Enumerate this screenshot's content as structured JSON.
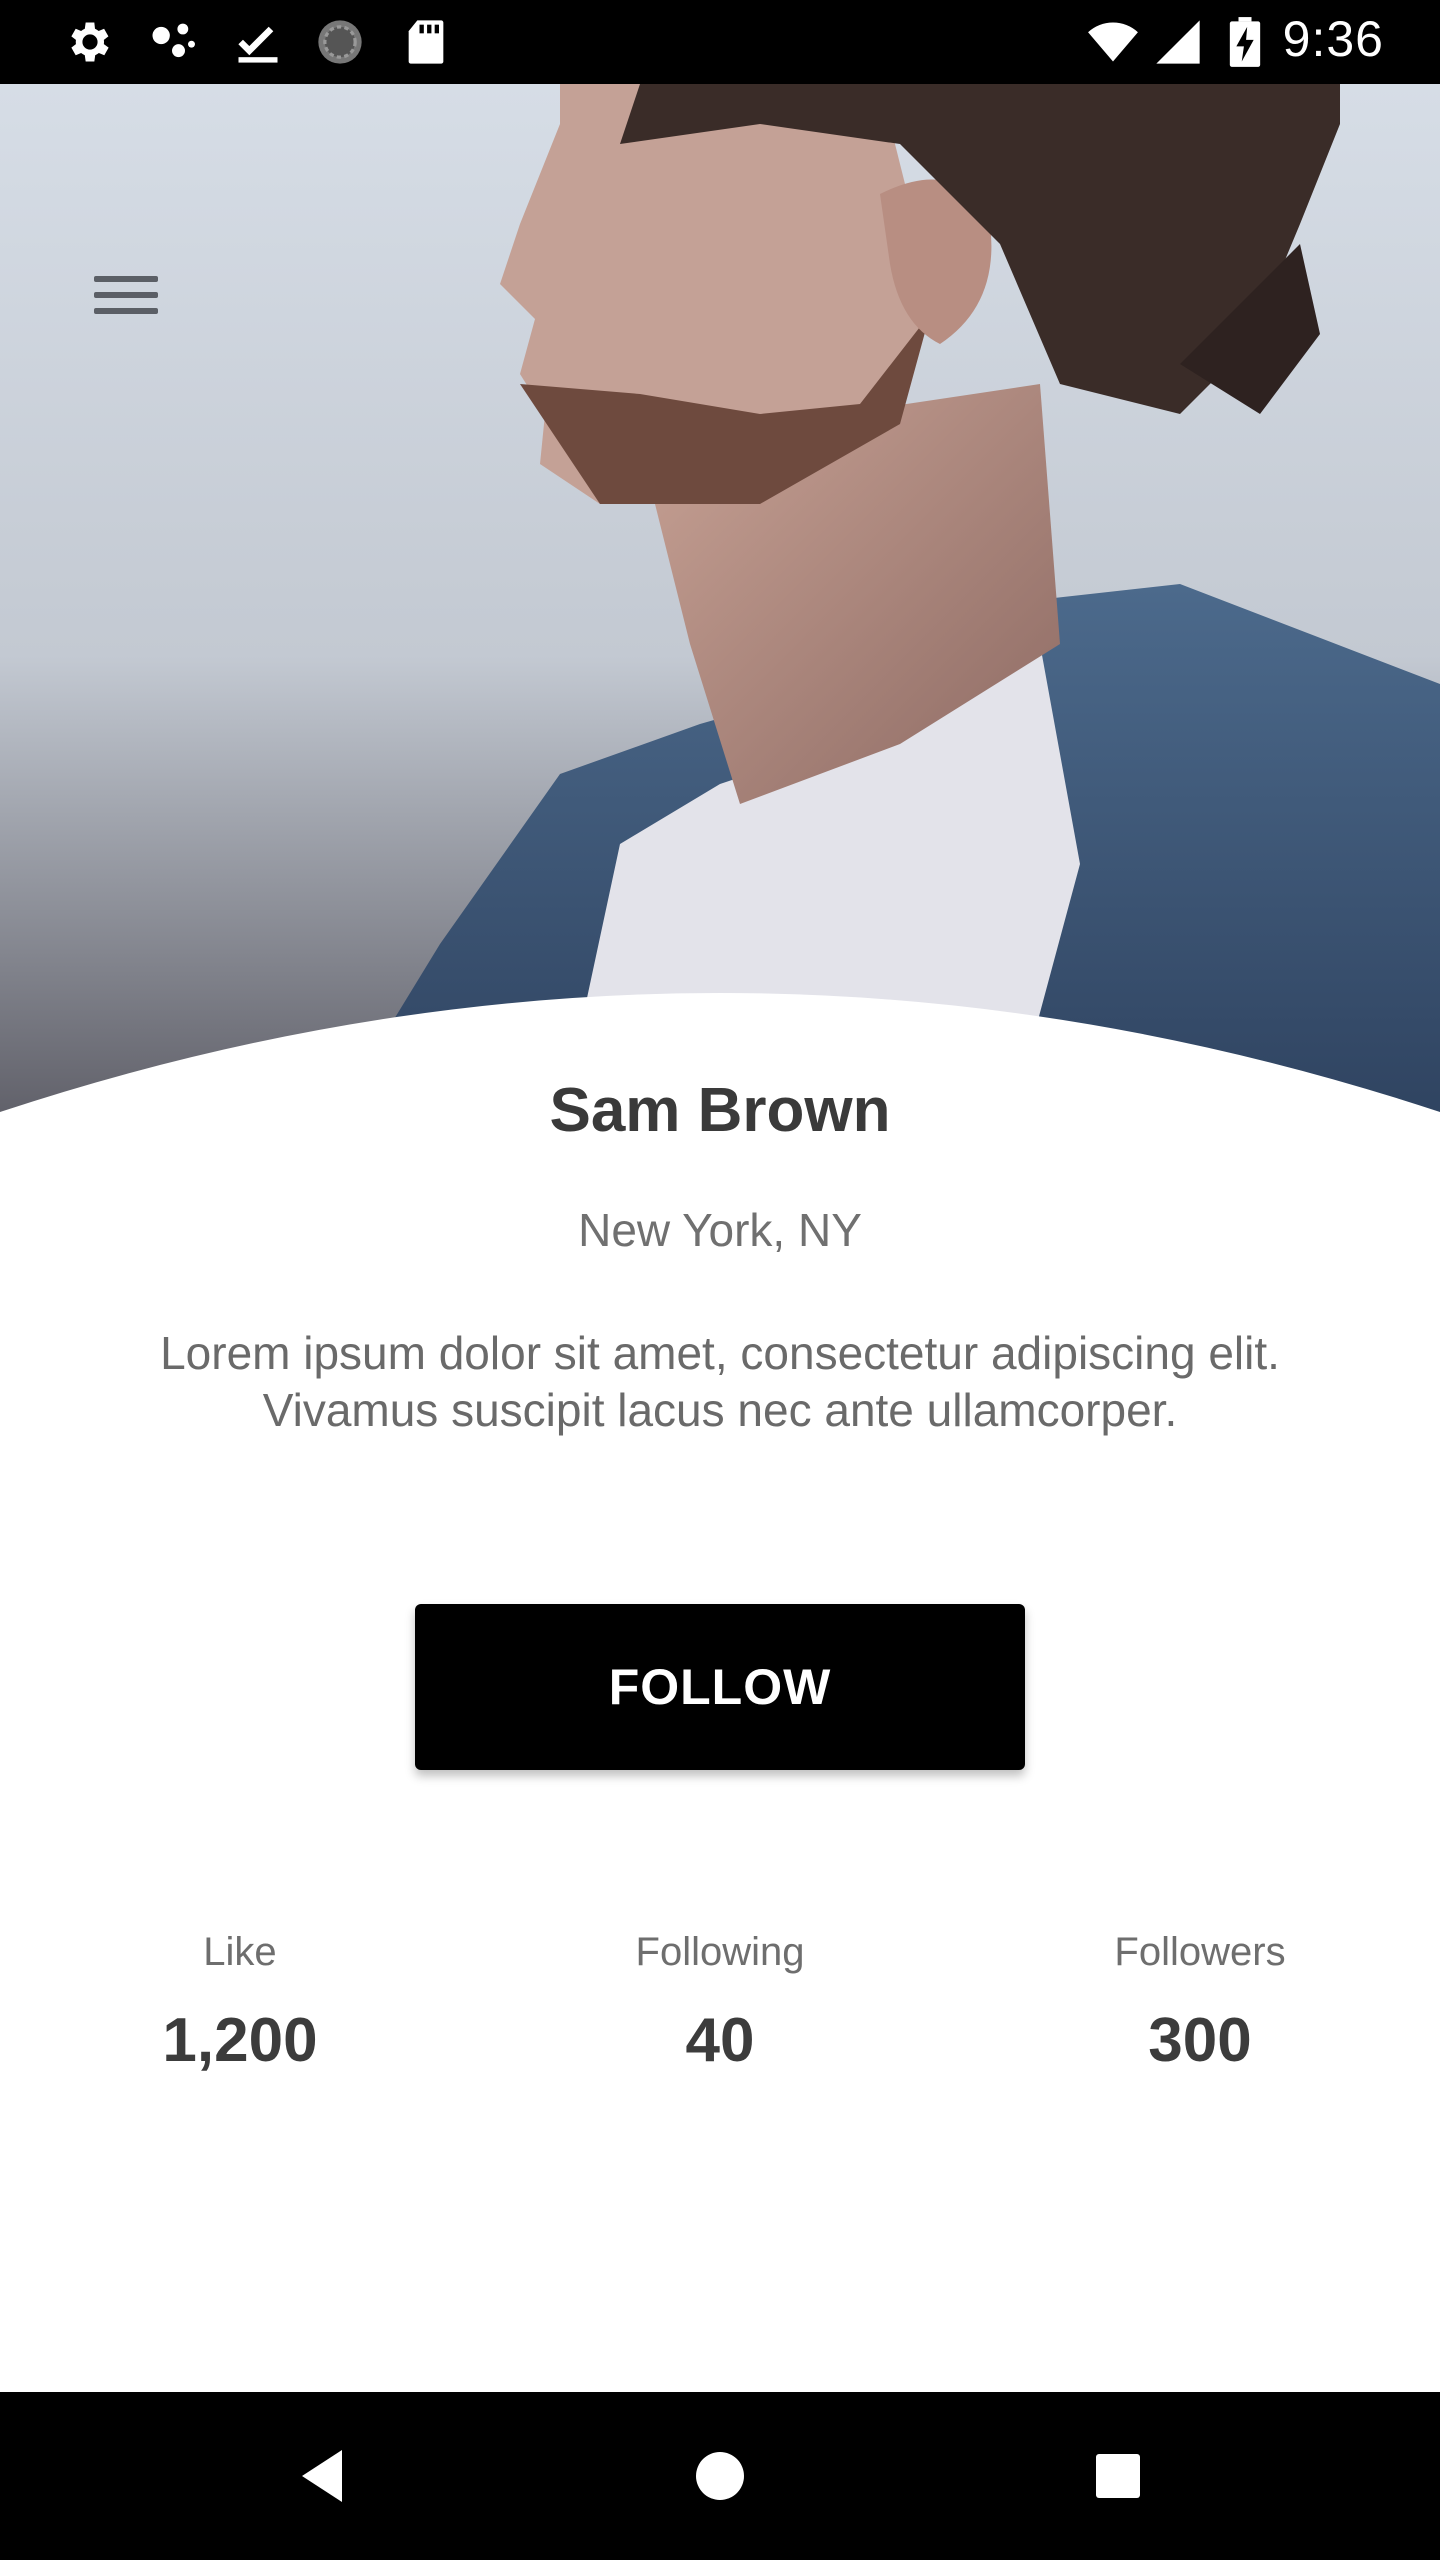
{
  "status_bar": {
    "time": "9:36",
    "left_icons": [
      "settings-icon",
      "share-dots-icon",
      "download-done-icon",
      "loading-circle-icon",
      "sd-card-icon"
    ],
    "right_icons": [
      "wifi-icon",
      "signal-icon",
      "battery-charging-icon"
    ]
  },
  "hero": {
    "image": "profile-photo-man-denim-jacket",
    "menu_icon": "hamburger-menu-icon"
  },
  "profile": {
    "name": "Sam Brown",
    "location": "New York, NY",
    "bio_line1": "Lorem ipsum dolor sit amet, consectetur adipiscing elit.",
    "bio_line2": "Vivamus suscipit lacus nec ante ullamcorper."
  },
  "actions": {
    "follow_label": "FOLLOW"
  },
  "stats": [
    {
      "label": "Like",
      "value": "1,200"
    },
    {
      "label": "Following",
      "value": "40"
    },
    {
      "label": "Followers",
      "value": "300"
    }
  ],
  "nav_bar": {
    "buttons": [
      "back-icon",
      "home-icon",
      "recents-icon"
    ]
  },
  "colors": {
    "button_bg": "#000000",
    "text_dark": "#3a3a3a",
    "text_muted": "#707070"
  }
}
